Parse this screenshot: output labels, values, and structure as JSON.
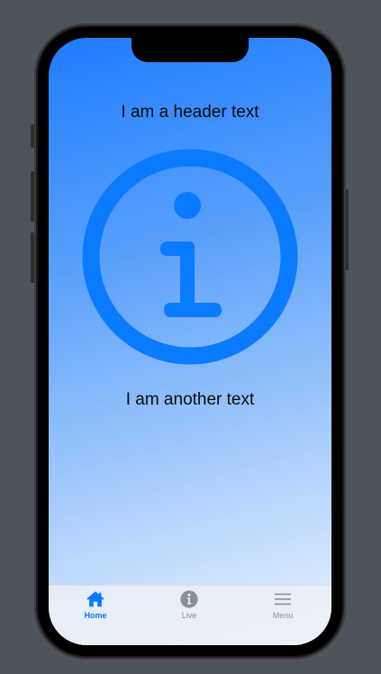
{
  "content": {
    "header_text": "I am a header text",
    "secondary_text": "I am another text"
  },
  "tab_bar": {
    "tabs": [
      {
        "label": "Home",
        "icon": "house-icon",
        "selected": true
      },
      {
        "label": "Live",
        "icon": "info-circle-icon",
        "selected": false
      },
      {
        "label": "Menu",
        "icon": "hamburger-menu-icon",
        "selected": false
      }
    ]
  },
  "colors": {
    "accent": "#0a7aff",
    "inactive_tab": "#8a8f98",
    "gradient_top": "#1f7cff",
    "gradient_bottom": "#e8f1fd",
    "device_background": "#4e545b"
  },
  "graphic": {
    "icon": "info-circle-icon"
  }
}
